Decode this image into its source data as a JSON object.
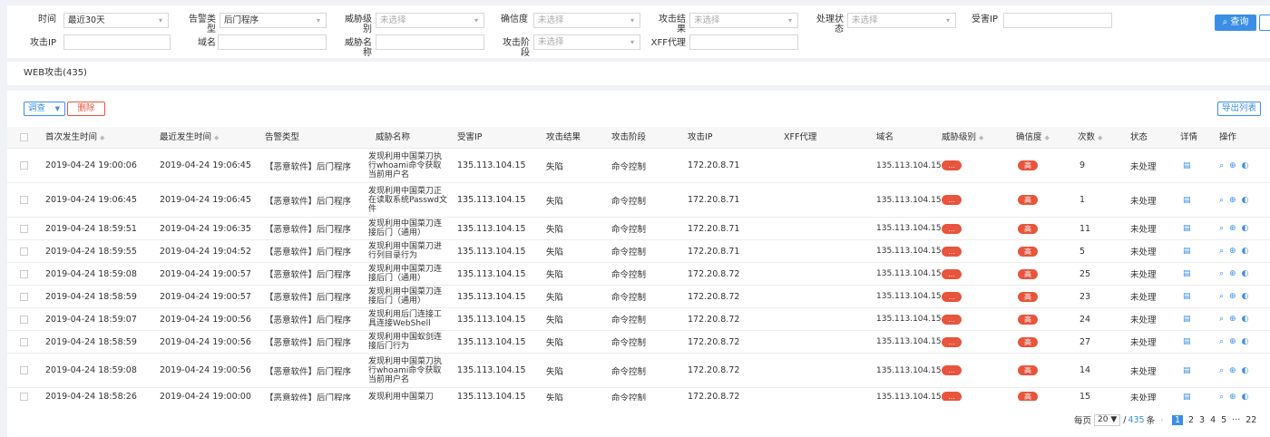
{
  "filters": {
    "time": {
      "label": "时间",
      "value": "最近30天"
    },
    "alert_type": {
      "label": "告警类型",
      "value": "后门程序"
    },
    "threat_level": {
      "label": "威胁级别",
      "placeholder": "未选择"
    },
    "confidence": {
      "label": "确信度",
      "placeholder": "未选择"
    },
    "attack_result": {
      "label": "攻击结果",
      "placeholder": "未选择"
    },
    "status": {
      "label": "处理状态",
      "placeholder": "未选择"
    },
    "victim_ip": {
      "label": "受害IP",
      "value": ""
    },
    "attack_ip": {
      "label": "攻击IP",
      "value": ""
    },
    "domain": {
      "label": "域名",
      "value": ""
    },
    "threat_name": {
      "label": "威胁名称",
      "value": ""
    },
    "attack_stage": {
      "label": "攻击阶段",
      "placeholder": "未选择"
    },
    "xff": {
      "label": "XFF代理",
      "value": ""
    },
    "query_button": "查询",
    "query_icon": "search-icon"
  },
  "section_title": "WEB攻击(435)",
  "toolbar": {
    "investigate_label": "调查",
    "delete_label": "删除",
    "export_label": "导出列表"
  },
  "columns": {
    "first_time": "首次发生时间",
    "last_time": "最近发生时间",
    "alert_type": "告警类型",
    "threat_name": "威胁名称",
    "victim_ip": "受害IP",
    "attack_result": "攻击结果",
    "attack_stage": "攻击阶段",
    "attack_ip": "攻击IP",
    "xff": "XFF代理",
    "domain": "域名",
    "threat_level": "威胁级别",
    "confidence": "确信度",
    "count": "次数",
    "status": "状态",
    "detail": "详情",
    "actions": "操作"
  },
  "rows": [
    {
      "first": "2019-04-24 19:00:06",
      "last": "2019-04-24 19:06:45",
      "type": "【恶意软件】后门程序",
      "threat": "发现利用中国菜刀执行whoami命令获取当前用户名",
      "victim": "135.113.104.15",
      "result": "失陷",
      "stage": "命令控制",
      "attacker": "172.20.8.71",
      "xff": "",
      "domain": "135.113.104.15",
      "level": "...",
      "conf": "高",
      "count": "9",
      "status": "未处理"
    },
    {
      "first": "2019-04-24 19:06:45",
      "last": "2019-04-24 19:06:45",
      "type": "【恶意软件】后门程序",
      "threat": "发现利用中国菜刀正在读取系统Passwd文件",
      "victim": "135.113.104.15",
      "result": "失陷",
      "stage": "命令控制",
      "attacker": "172.20.8.71",
      "xff": "",
      "domain": "135.113.104.15",
      "level": "...",
      "conf": "高",
      "count": "1",
      "status": "未处理"
    },
    {
      "first": "2019-04-24 18:59:51",
      "last": "2019-04-24 19:06:35",
      "type": "【恶意软件】后门程序",
      "threat": "发现利用中国菜刀连接后门（通用）",
      "victim": "135.113.104.15",
      "result": "失陷",
      "stage": "命令控制",
      "attacker": "172.20.8.71",
      "xff": "",
      "domain": "135.113.104.15",
      "level": "...",
      "conf": "高",
      "count": "11",
      "status": "未处理"
    },
    {
      "first": "2019-04-24 18:59:55",
      "last": "2019-04-24 19:04:52",
      "type": "【恶意软件】后门程序",
      "threat": "发现利用中国菜刀进行列目录行为",
      "victim": "135.113.104.15",
      "result": "失陷",
      "stage": "命令控制",
      "attacker": "172.20.8.71",
      "xff": "",
      "domain": "135.113.104.15",
      "level": "...",
      "conf": "高",
      "count": "5",
      "status": "未处理"
    },
    {
      "first": "2019-04-24 18:59:08",
      "last": "2019-04-24 19:00:57",
      "type": "【恶意软件】后门程序",
      "threat": "发现利用中国菜刀连接后门（通用）",
      "victim": "135.113.104.15",
      "result": "失陷",
      "stage": "命令控制",
      "attacker": "172.20.8.72",
      "xff": "",
      "domain": "135.113.104.15",
      "level": "...",
      "conf": "高",
      "count": "25",
      "status": "未处理"
    },
    {
      "first": "2019-04-24 18:58:59",
      "last": "2019-04-24 19:00:57",
      "type": "【恶意软件】后门程序",
      "threat": "发现利用中国菜刀连接后门（通用）",
      "victim": "135.113.104.15",
      "result": "失陷",
      "stage": "命令控制",
      "attacker": "172.20.8.72",
      "xff": "",
      "domain": "135.113.104.15",
      "level": "...",
      "conf": "高",
      "count": "23",
      "status": "未处理"
    },
    {
      "first": "2019-04-24 18:59:07",
      "last": "2019-04-24 19:00:56",
      "type": "【恶意软件】后门程序",
      "threat": "发现利用后门连接工具连接WebShell",
      "victim": "135.113.104.15",
      "result": "失陷",
      "stage": "命令控制",
      "attacker": "172.20.8.72",
      "xff": "",
      "domain": "135.113.104.15",
      "level": "...",
      "conf": "高",
      "count": "24",
      "status": "未处理"
    },
    {
      "first": "2019-04-24 18:58:59",
      "last": "2019-04-24 19:00:56",
      "type": "【恶意软件】后门程序",
      "threat": "发现利用中国蚁剑连接后门行为",
      "victim": "135.113.104.15",
      "result": "失陷",
      "stage": "命令控制",
      "attacker": "172.20.8.72",
      "xff": "",
      "domain": "135.113.104.15",
      "level": "...",
      "conf": "高",
      "count": "27",
      "status": "未处理"
    },
    {
      "first": "2019-04-24 18:59:08",
      "last": "2019-04-24 19:00:56",
      "type": "【恶意软件】后门程序",
      "threat": "发现利用中国菜刀执行whoami命令获取当前用户名",
      "victim": "135.113.104.15",
      "result": "失陷",
      "stage": "命令控制",
      "attacker": "172.20.8.72",
      "xff": "",
      "domain": "135.113.104.15",
      "level": "...",
      "conf": "高",
      "count": "14",
      "status": "未处理"
    },
    {
      "first": "2019-04-24 18:58:26",
      "last": "2019-04-24 19:00:00",
      "type": "【恶意软件】后门程序",
      "threat": "发现利用中国菜刀",
      "victim": "135.113.104.15",
      "result": "失陷",
      "stage": "命令控制",
      "attacker": "172.20.8.72",
      "xff": "",
      "domain": "135.113.104.15",
      "level": "...",
      "conf": "高",
      "count": "15",
      "status": "未处理"
    }
  ],
  "pagination": {
    "per_page_label": "每页",
    "per_page_value": "20",
    "total_prefix": "/",
    "total": "435",
    "total_suffix": "条",
    "pages": [
      "1",
      "2",
      "3",
      "4",
      "5"
    ],
    "ellipsis": "···",
    "last_page": "22"
  },
  "colors": {
    "accent": "#3a8ee6",
    "danger": "#e8543c"
  }
}
